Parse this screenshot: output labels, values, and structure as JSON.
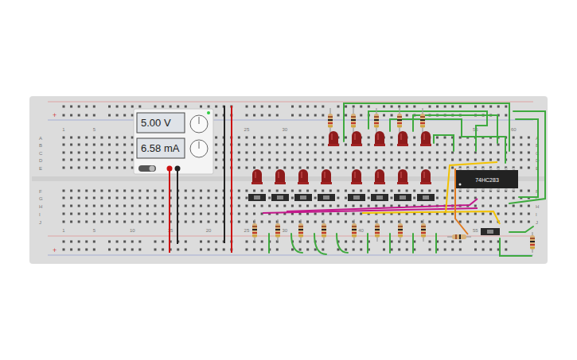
{
  "power_supply": {
    "voltage": "5.00 V",
    "current": "6.58 mA",
    "output_on": true
  },
  "chip": {
    "label": "74HC283"
  },
  "column_labels_top": [
    "1",
    "5",
    "25",
    "30",
    "55",
    "60"
  ],
  "column_labels_bottom": [
    "1",
    "5",
    "10",
    "15",
    "20",
    "25",
    "30",
    "40",
    "55"
  ],
  "row_labels": [
    "A",
    "B",
    "C",
    "D",
    "E",
    "F",
    "G",
    "H",
    "I",
    "J"
  ],
  "rail_marks": [
    "+",
    "+"
  ],
  "leds_top": [
    {
      "lit": false
    },
    {
      "lit": false
    },
    {
      "lit": false
    },
    {
      "lit": false
    },
    {
      "lit": false
    }
  ],
  "leds_bottom": [
    {
      "lit": false
    },
    {
      "lit": false
    },
    {
      "lit": false
    },
    {
      "lit": false
    },
    {
      "lit": false
    },
    {
      "lit": false
    },
    {
      "lit": false
    },
    {
      "lit": false
    }
  ]
}
